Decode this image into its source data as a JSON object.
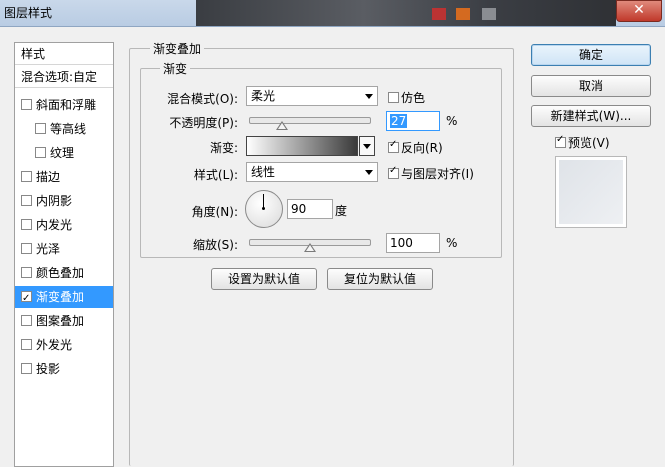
{
  "window": {
    "title": "图层样式",
    "close": "✕"
  },
  "styles_panel": {
    "header": "样式",
    "blend_options": "混合选项:自定",
    "items": [
      {
        "label": "斜面和浮雕",
        "checked": false,
        "indent": false
      },
      {
        "label": "等高线",
        "checked": false,
        "indent": true
      },
      {
        "label": "纹理",
        "checked": false,
        "indent": true
      },
      {
        "label": "描边",
        "checked": false,
        "indent": false
      },
      {
        "label": "内阴影",
        "checked": false,
        "indent": false
      },
      {
        "label": "内发光",
        "checked": false,
        "indent": false
      },
      {
        "label": "光泽",
        "checked": false,
        "indent": false
      },
      {
        "label": "颜色叠加",
        "checked": false,
        "indent": false
      },
      {
        "label": "渐变叠加",
        "checked": true,
        "indent": false,
        "selected": true
      },
      {
        "label": "图案叠加",
        "checked": false,
        "indent": false
      },
      {
        "label": "外发光",
        "checked": false,
        "indent": false
      },
      {
        "label": "投影",
        "checked": false,
        "indent": false
      }
    ]
  },
  "gradient_overlay": {
    "group_title": "渐变叠加",
    "subgroup_title": "渐变",
    "blend_mode_label": "混合模式(O):",
    "blend_mode_value": "柔光",
    "dither_label": "仿色",
    "dither_checked": false,
    "opacity_label": "不透明度(P):",
    "opacity_value": "27",
    "opacity_unit": "%",
    "opacity_fraction": 0.27,
    "gradient_label": "渐变:",
    "gradient_colors": [
      "#ffffff",
      "#3a3a3a"
    ],
    "reverse_label": "反向(R)",
    "reverse_checked": true,
    "style_label": "样式(L):",
    "style_value": "线性",
    "align_label": "与图层对齐(I)",
    "align_checked": true,
    "angle_label": "角度(N):",
    "angle_value": "90",
    "angle_unit": "度",
    "scale_label": "缩放(S):",
    "scale_value": "100",
    "scale_unit": "%",
    "scale_fraction": 0.5,
    "set_default_button": "设置为默认值",
    "reset_default_button": "复位为默认值"
  },
  "actions": {
    "ok": "确定",
    "cancel": "取消",
    "new_style": "新建样式(W)...",
    "preview_label": "预览(V)",
    "preview_checked": true
  }
}
